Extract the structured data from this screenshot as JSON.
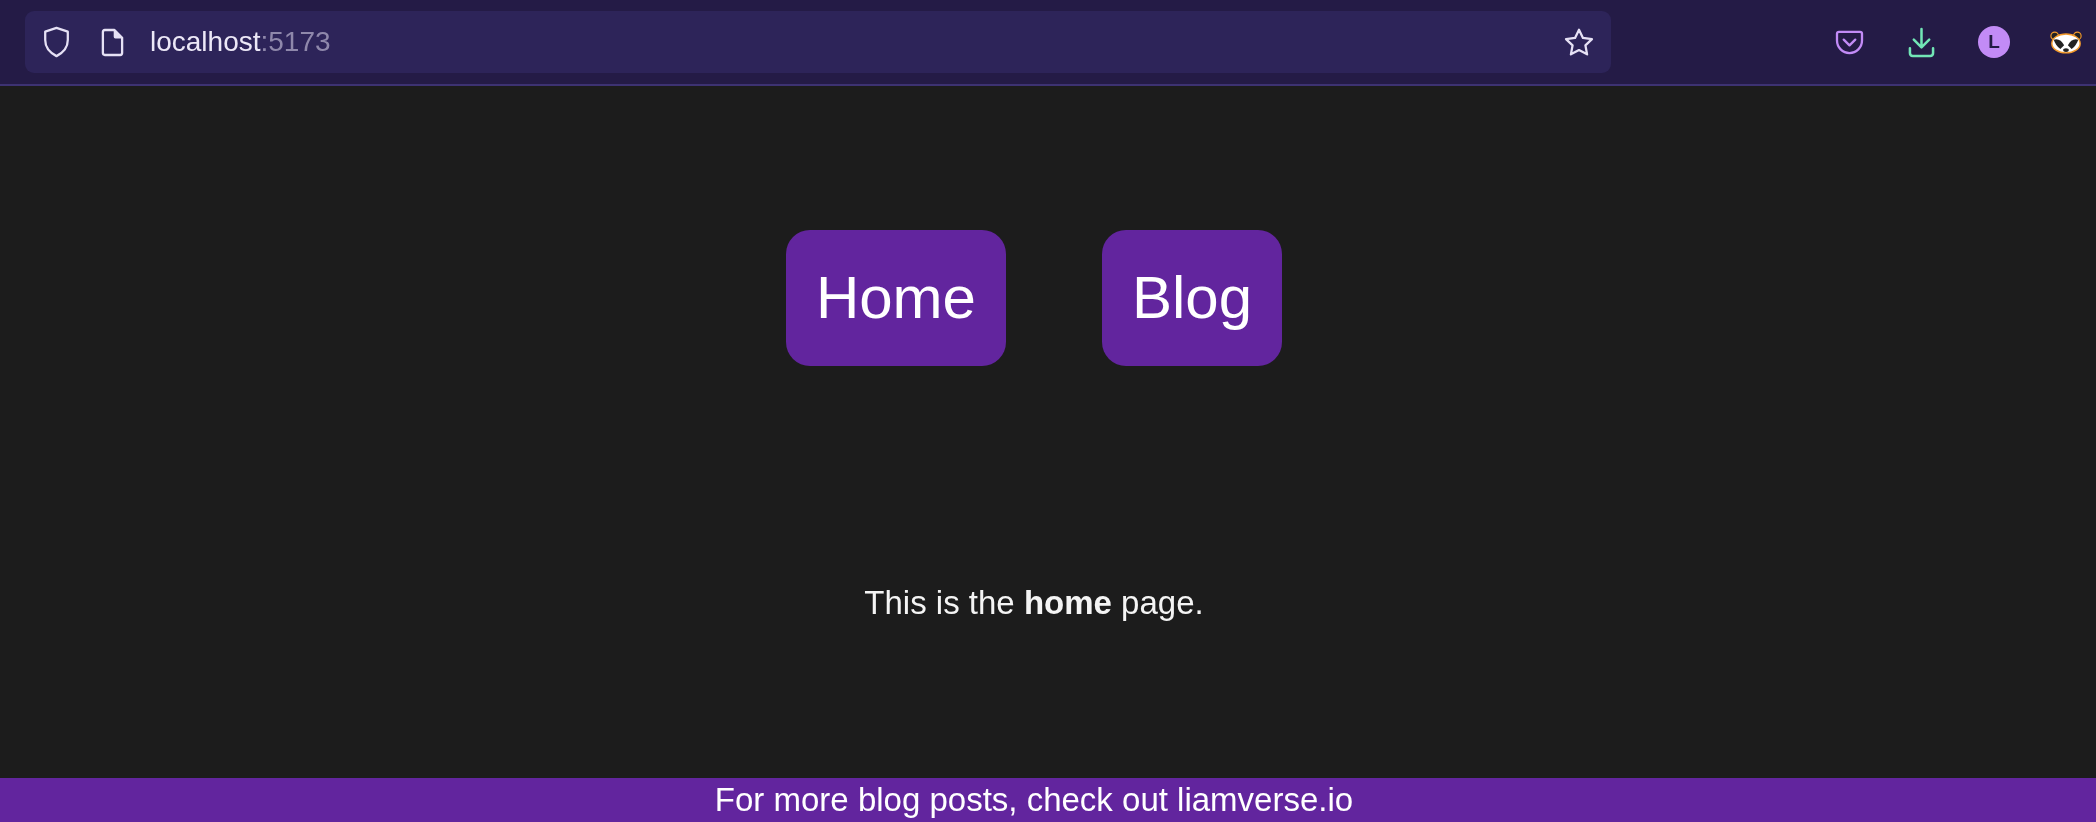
{
  "browser": {
    "address_bar": {
      "host": "localhost",
      "port": ":5173"
    },
    "profile": {
      "initial": "L"
    }
  },
  "nav": [
    {
      "label": "Home"
    },
    {
      "label": "Blog"
    }
  ],
  "content": {
    "message": "This is the **home** page."
  },
  "footer": {
    "text": "For more blog posts, check out liamverse.io"
  }
}
